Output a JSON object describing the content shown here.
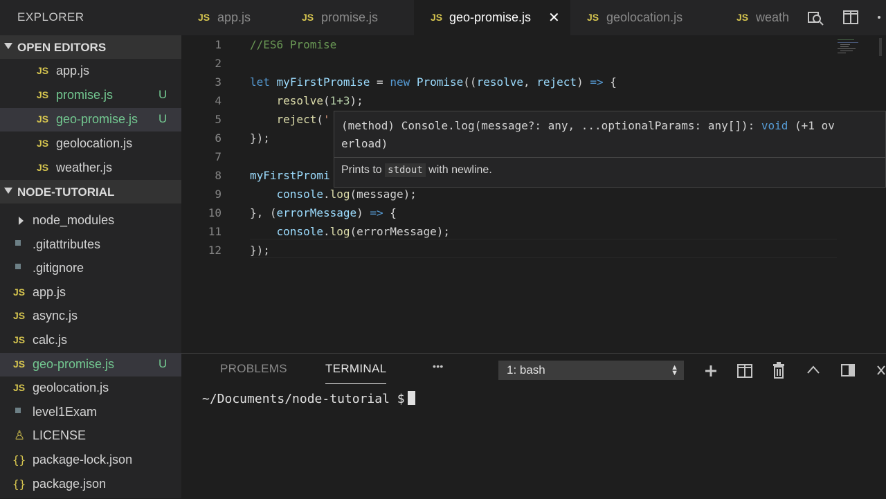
{
  "sidebar": {
    "title": "EXPLORER",
    "open_editors_label": "OPEN EDITORS",
    "open_editors": [
      {
        "name": "app.js",
        "badge": ""
      },
      {
        "name": "promise.js",
        "badge": "U"
      },
      {
        "name": "geo-promise.js",
        "badge": "U"
      },
      {
        "name": "geolocation.js",
        "badge": ""
      },
      {
        "name": "weather.js",
        "badge": ""
      }
    ],
    "project_label": "NODE-TUTORIAL",
    "files": [
      {
        "name": "node_modules"
      },
      {
        "name": ".gitattributes"
      },
      {
        "name": ".gitignore"
      },
      {
        "name": "app.js"
      },
      {
        "name": "async.js"
      },
      {
        "name": "calc.js"
      },
      {
        "name": "geo-promise.js",
        "badge": "U"
      },
      {
        "name": "geolocation.js"
      },
      {
        "name": "level1Exam"
      },
      {
        "name": "LICENSE"
      },
      {
        "name": "package-lock.json"
      },
      {
        "name": "package.json"
      }
    ]
  },
  "tabs": [
    {
      "name": "app.js"
    },
    {
      "name": "promise.js"
    },
    {
      "name": "geo-promise.js",
      "close": "✕"
    },
    {
      "name": "geolocation.js"
    },
    {
      "name": "weath"
    }
  ],
  "file_icon_label": "JS",
  "editor": {
    "line_numbers": [
      "1",
      "2",
      "3",
      "4",
      "5",
      "6",
      "7",
      "8",
      "9",
      "10",
      "11",
      "12"
    ],
    "code": {
      "l1": "//ES6 Promise",
      "l3_let": "let",
      "l3_var": "myFirstPromise",
      "l3_eq": " = ",
      "l3_new": "new",
      "l3_promise": "Promise",
      "l3_args": "((",
      "l3_resolve": "resolve",
      "l3_comma": ", ",
      "l3_reject": "reject",
      "l3_close": ") ",
      "l3_arrow": "=>",
      "l3_brace": " {",
      "l4_fn": "resolve",
      "l4_open": "(",
      "l4_num": "1+3",
      "l4_close": ");",
      "l5_fn": "reject",
      "l5_open": "(",
      "l5_str": "'",
      "l6": "});",
      "l8": "myFirstPromi",
      "l9_obj": "console",
      "l9_dot": ".",
      "l9_fn": "log",
      "l9_arg": "(message);",
      "l10_a": "}, (",
      "l10_param": "errorMessage",
      "l10_b": ") ",
      "l10_arrow": "=>",
      "l10_c": " {",
      "l11_obj": "console",
      "l11_dot": ".",
      "l11_fn": "log",
      "l11_arg": "(errorMessage);",
      "l12": "});"
    }
  },
  "hover": {
    "sig_a": "(method) Console.log(message?: any, ...optionalParams: any[]): ",
    "sig_void": "void",
    "sig_b": " (+1 ov",
    "sig_c": "erload)",
    "doc_a": "Prints to ",
    "doc_code": "stdout",
    "doc_b": " with newline."
  },
  "panel": {
    "tab_problems": "PROBLEMS",
    "tab_terminal": "TERMINAL",
    "more": "•••",
    "terminal_select": "1: bash",
    "prompt": "~/Documents/node-tutorial $"
  }
}
